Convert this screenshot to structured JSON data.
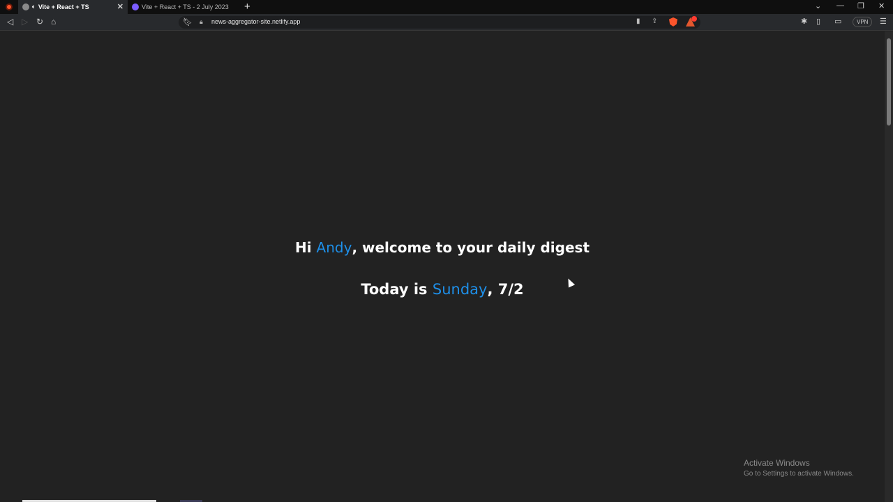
{
  "browser": {
    "tabs": [
      {
        "title": "Vite + React + TS",
        "active": true,
        "audio_icon": "speaker-icon"
      },
      {
        "title": "Vite + React + TS - 2 July 2023",
        "active": false
      }
    ],
    "new_tab": "+",
    "url": "news-aggregator-site.netlify.app",
    "vpn_label": "VPN",
    "window_controls": {
      "minimize": "—",
      "restore": "❐",
      "close": "✕",
      "dropdown": "⌄"
    }
  },
  "page": {
    "greeting": {
      "prefix": "Hi ",
      "name": "Andy",
      "suffix": ", welcome to your daily digest"
    },
    "today": {
      "prefix": "Today is ",
      "day": "Sunday",
      "suffix": ", 7/2"
    },
    "accent_color": "#1e8fe8"
  },
  "os": {
    "watermark_title": "Activate Windows",
    "watermark_subtitle": "Go to Settings to activate Windows."
  }
}
